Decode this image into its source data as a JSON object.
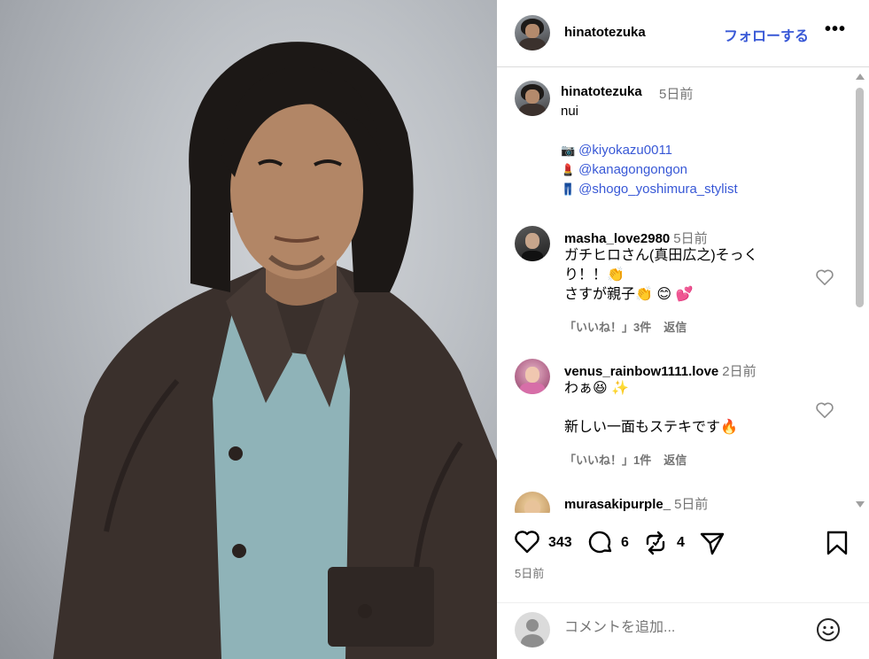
{
  "header": {
    "username": "hinatotezuka",
    "follow_label": "フォローする",
    "more_label": "•••"
  },
  "caption": {
    "username": "hinatotezuka",
    "time": "5日前",
    "text": "nui",
    "credits": [
      {
        "emoji": "📷",
        "mention": "@kiyokazu0011"
      },
      {
        "emoji": "💄",
        "mention": "@kanagongongon"
      },
      {
        "emoji": "👖",
        "mention": "@shogo_yoshimura_stylist"
      }
    ]
  },
  "comments": [
    {
      "username": "masha_love2980",
      "time": "5日前",
      "lines": [
        "ガチヒロさん(真田広之)そっく",
        "り！！👏",
        "さすが親子👏 😊 💕"
      ],
      "likes": "「いいね！」3件",
      "reply": "返信"
    },
    {
      "username": "venus_rainbow1111.love",
      "time": "2日前",
      "lines": [
        "わぁ😆 ✨",
        "",
        "新しい一面もステキです🔥"
      ],
      "likes": "「いいね！」1件",
      "reply": "返信"
    },
    {
      "username": "murasakipurple_",
      "time": "5日前"
    }
  ],
  "actions": {
    "like_count": "343",
    "comment_count": "6",
    "repost_count": "4"
  },
  "post_time": "5日前",
  "add_comment": {
    "placeholder": "コメントを追加..."
  },
  "icons": {
    "like": "heart-icon",
    "comment": "comment-bubble-icon",
    "repost": "repost-icon",
    "share": "send-icon",
    "save": "bookmark-icon",
    "emoji": "smiley-icon"
  },
  "colors": {
    "link": "#3858d6",
    "secondary_text": "#737373",
    "divider": "#dbdbdb"
  }
}
